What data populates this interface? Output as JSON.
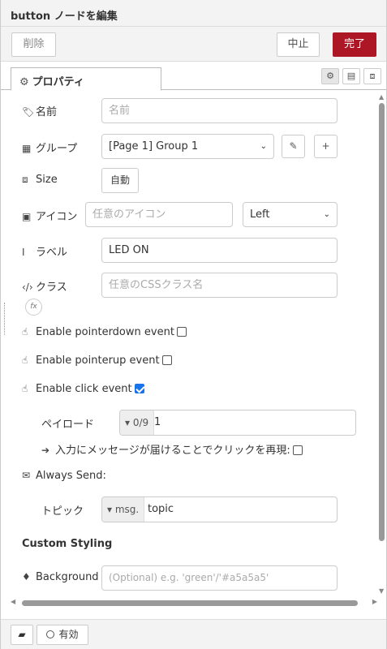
{
  "tray": {
    "title": "button ノードを編集"
  },
  "toolbar": {
    "delete_label": "削除",
    "cancel_label": "中止",
    "done_label": "完了"
  },
  "tabs": {
    "properties_label": "プロパティ"
  },
  "form": {
    "name": {
      "label": "名前",
      "placeholder": "名前"
    },
    "group": {
      "label": "グループ",
      "value": "[Page 1] Group 1"
    },
    "size": {
      "label": "Size",
      "value": "自動"
    },
    "icon": {
      "label": "アイコン",
      "placeholder": "任意のアイコン",
      "position": "Left"
    },
    "label": {
      "label": "ラベル",
      "value": "LED ON"
    },
    "class": {
      "label": "クラス",
      "placeholder": "任意のCSSクラス名",
      "fx": "fx"
    },
    "pointerdown": {
      "label": "Enable pointerdown event",
      "checked": false
    },
    "pointerup": {
      "label": "Enable pointerup event",
      "checked": false
    },
    "click": {
      "label": "Enable click event",
      "checked": true
    },
    "payload": {
      "label": "ペイロード",
      "type": "0/9",
      "value": "1"
    },
    "emulate": {
      "label": "入力にメッセージが届けることでクリックを再現:",
      "checked": false
    },
    "always_send": {
      "label": "Always Send:"
    },
    "topic": {
      "label": "トピック",
      "type": "msg.",
      "value": "topic"
    },
    "custom_styling": {
      "title": "Custom Styling"
    },
    "background": {
      "label": "Background",
      "placeholder": "(Optional) e.g. 'green'/'#a5a5a5'"
    }
  },
  "footer": {
    "enabled_label": "有効"
  },
  "colors": {
    "done_button": "#ad1625",
    "checkbox_checked": "#1a73e8"
  }
}
